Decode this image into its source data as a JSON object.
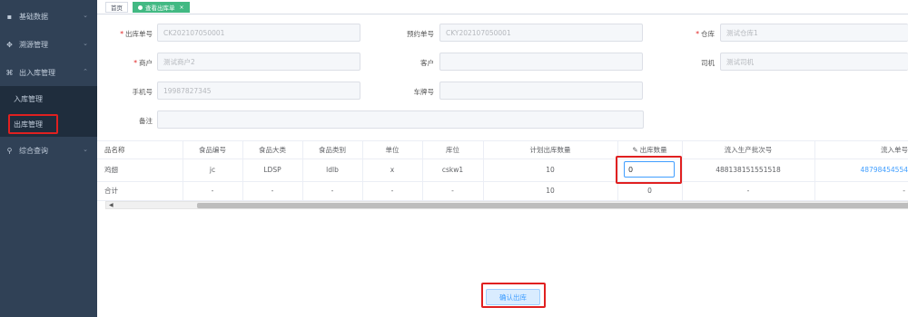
{
  "sidebar": {
    "items": [
      {
        "icon": "grid-icon",
        "glyph": "▪",
        "label": "基础数据"
      },
      {
        "icon": "expand-icon",
        "glyph": "✥",
        "label": "溯源管理"
      },
      {
        "icon": "shrink-icon",
        "glyph": "⌘",
        "label": "出入库管理"
      },
      {
        "icon": "search-icon",
        "glyph": "⚲",
        "label": "综合查询"
      }
    ],
    "sub_items": [
      {
        "label": "入库管理"
      },
      {
        "label": "出库管理"
      }
    ]
  },
  "tabs": [
    {
      "label": "首页"
    },
    {
      "label": "查看出库单"
    }
  ],
  "form": {
    "outbound_no": {
      "label": "出库单号",
      "value": "CK202107050001"
    },
    "reserve_no": {
      "label": "预约单号",
      "value": "CKY202107050001"
    },
    "warehouse": {
      "label": "仓库",
      "value": "测试仓库1"
    },
    "merchant": {
      "label": "商户",
      "value": "测试商户2"
    },
    "customer": {
      "label": "客户",
      "value": ""
    },
    "driver": {
      "label": "司机",
      "value": "测试司机"
    },
    "phone": {
      "label": "手机号",
      "value": "19987827345"
    },
    "plate": {
      "label": "车牌号",
      "value": ""
    },
    "remark": {
      "label": "备注",
      "value": ""
    }
  },
  "table": {
    "headers": [
      "品名称",
      "食品编号",
      "食品大类",
      "食品类别",
      "单位",
      "库位",
      "计划出库数量",
      "出库数量",
      "流入生产批次号",
      "流入单号"
    ],
    "rows": [
      [
        "鸡翅",
        "jc",
        "LDSP",
        "ldlb",
        "x",
        "cskw1",
        "10",
        "0",
        "488138151551518",
        "48798454554"
      ]
    ],
    "total_row": [
      "合计",
      "-",
      "-",
      "-",
      "-",
      "-",
      "10",
      "0",
      "-",
      "-"
    ]
  },
  "confirm_button": "确认出库",
  "colors": {
    "sidebar": "#304156",
    "active_tab": "#42b983",
    "highlight": "#e02020",
    "link": "#409eff"
  }
}
